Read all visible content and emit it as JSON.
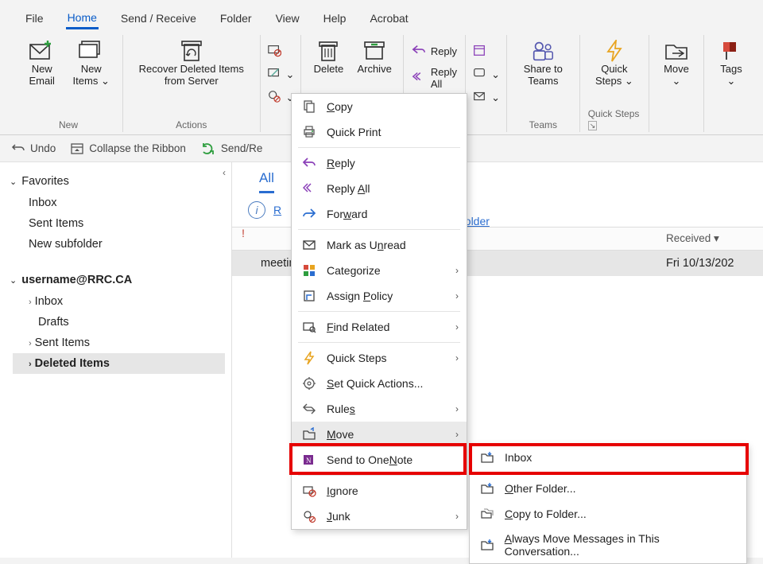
{
  "tabs": [
    "File",
    "Home",
    "Send / Receive",
    "Folder",
    "View",
    "Help",
    "Acrobat"
  ],
  "active_tab": 1,
  "ribbon": {
    "new": {
      "label": "New",
      "new_email": "New\nEmail",
      "new_items": "New\nItems ⌄"
    },
    "actions": {
      "label": "Actions",
      "recover": "Recover Deleted\nItems from Server"
    },
    "delete_group": {
      "delete": "Delete",
      "archive": "Archive"
    },
    "respond": {
      "reply": "Reply",
      "reply_all": "Reply All",
      "forward": ""
    },
    "teams": {
      "label": "Teams",
      "share": "Share to\nTeams"
    },
    "quick_steps": {
      "label": "Quick Steps",
      "btn": "Quick\nSteps ⌄"
    },
    "move": {
      "btn": "Move\n⌄"
    },
    "tags": {
      "btn": "Tags\n⌄"
    }
  },
  "qat": {
    "undo": "Undo",
    "collapse": "Collapse the Ribbon",
    "sendrec": "Send/Re"
  },
  "nav": {
    "favorites": "Favorites",
    "fav_items": [
      "Inbox",
      "Sent Items",
      "New subfolder"
    ],
    "account": "username@RRC.CA",
    "folders": [
      {
        "label": "Inbox",
        "expandable": true
      },
      {
        "label": "Drafts",
        "expandable": false
      },
      {
        "label": "Sent Items",
        "expandable": true
      },
      {
        "label": "Deleted Items",
        "expandable": true,
        "selected": true
      }
    ]
  },
  "list": {
    "tabs": [
      "All"
    ],
    "info_link": "s folder",
    "info_prefix": "R",
    "col_subject": "",
    "col_received": "Received ▾",
    "row_subject": "meeting tomorrow",
    "row_received": "Fri 10/13/202"
  },
  "context": [
    {
      "icon": "copy",
      "label": "Copy",
      "u": "C"
    },
    {
      "icon": "print",
      "label": "Quick Print",
      "u": ""
    },
    {
      "sep": true
    },
    {
      "icon": "reply",
      "label": "Reply",
      "u": "R"
    },
    {
      "icon": "replyall",
      "label": "Reply All",
      "u": "A"
    },
    {
      "icon": "forward",
      "label": "Forward",
      "u": "w"
    },
    {
      "sep": true
    },
    {
      "icon": "mail",
      "label": "Mark as Unread",
      "u": "n"
    },
    {
      "icon": "cat",
      "label": "Categorize",
      "u": "",
      "sub": true
    },
    {
      "icon": "policy",
      "label": "Assign Policy",
      "u": "P",
      "sub": true
    },
    {
      "sep": true
    },
    {
      "icon": "find",
      "label": "Find Related",
      "u": "F",
      "sub": true
    },
    {
      "sep": true
    },
    {
      "icon": "qs",
      "label": "Quick Steps",
      "u": "",
      "sub": true
    },
    {
      "icon": "qa",
      "label": "Set Quick Actions...",
      "u": "S"
    },
    {
      "icon": "rules",
      "label": "Rules",
      "u": "s",
      "sub": true
    },
    {
      "icon": "move",
      "label": "Move",
      "u": "M",
      "sub": true,
      "hl": true
    },
    {
      "icon": "onenote",
      "label": "Send to OneNote",
      "u": "N"
    },
    {
      "sep": true
    },
    {
      "icon": "ignore",
      "label": "Ignore",
      "u": "I"
    },
    {
      "icon": "junk",
      "label": "Junk",
      "u": "J",
      "sub": true
    }
  ],
  "submenu": [
    {
      "icon": "inbox",
      "label": "Inbox",
      "u": ""
    },
    {
      "icon": "folder",
      "label": "Other Folder...",
      "u": "O"
    },
    {
      "icon": "copyto",
      "label": "Copy to Folder...",
      "u": "C"
    },
    {
      "icon": "always",
      "label": "Always Move Messages in This Conversation...",
      "u": "A"
    }
  ]
}
